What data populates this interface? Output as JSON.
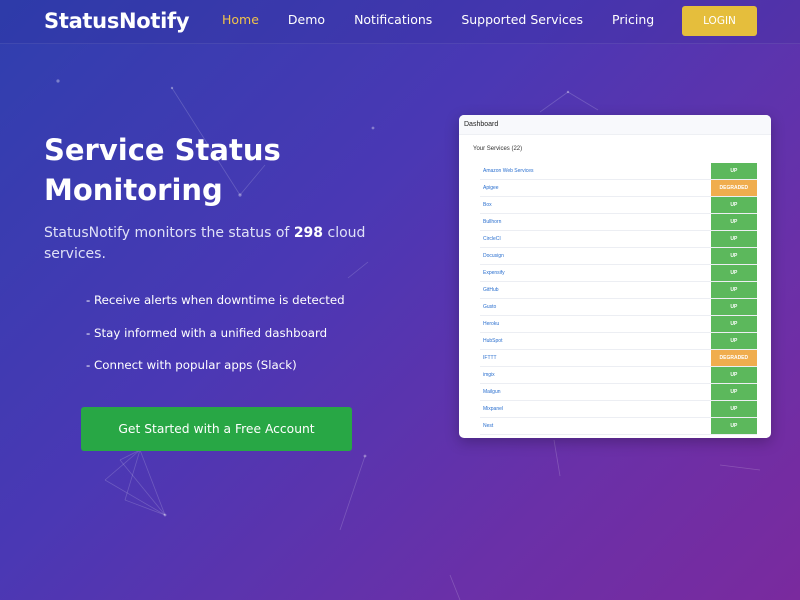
{
  "navbar": {
    "brand": "StatusNotify",
    "links": [
      "Home",
      "Demo",
      "Notifications",
      "Supported Services",
      "Pricing"
    ],
    "active_link": "Home",
    "login_label": "LOGIN"
  },
  "hero": {
    "title": "Service Status Monitoring",
    "subtitle_pre": "StatusNotify monitors the status of ",
    "service_count": "298",
    "subtitle_post": " cloud services.",
    "features": [
      "- Receive alerts when downtime is detected",
      "- Stay informed with a unified dashboard",
      "- Connect with popular apps (Slack)"
    ],
    "cta_label": "Get Started with a Free Account"
  },
  "dashboard": {
    "title": "Dashboard",
    "subtitle": "Your Services (22)",
    "services": [
      {
        "name": "Amazon Web Services",
        "status": "UP"
      },
      {
        "name": "Apigee",
        "status": "DEGRADED"
      },
      {
        "name": "Box",
        "status": "UP"
      },
      {
        "name": "Bullhorn",
        "status": "UP"
      },
      {
        "name": "CircleCI",
        "status": "UP"
      },
      {
        "name": "Docusign",
        "status": "UP"
      },
      {
        "name": "Expensify",
        "status": "UP"
      },
      {
        "name": "GitHub",
        "status": "UP"
      },
      {
        "name": "Gusto",
        "status": "UP"
      },
      {
        "name": "Heroku",
        "status": "UP"
      },
      {
        "name": "HubSpot",
        "status": "UP"
      },
      {
        "name": "IFTTT",
        "status": "DEGRADED"
      },
      {
        "name": "imgix",
        "status": "UP"
      },
      {
        "name": "Mailgun",
        "status": "UP"
      },
      {
        "name": "Mixpanel",
        "status": "UP"
      },
      {
        "name": "Nest",
        "status": "UP"
      }
    ]
  },
  "colors": {
    "up": "#5cb85c",
    "degraded": "#f0ad4e",
    "accent": "#e5be3c",
    "cta": "#28a745"
  }
}
